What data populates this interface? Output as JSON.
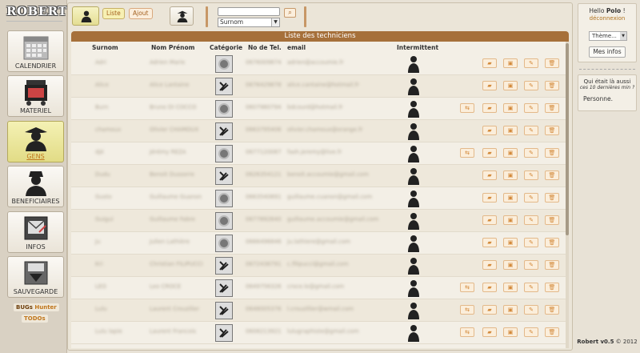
{
  "app": {
    "logo": "ROBERT"
  },
  "sidebar": {
    "items": [
      {
        "label": "CALENDRIER",
        "icon": "calendar-icon"
      },
      {
        "label": "MATERIEL",
        "icon": "equipment-icon"
      },
      {
        "label": "GENS",
        "icon": "people-icon",
        "active": true
      },
      {
        "label": "BENEFICIAIRES",
        "icon": "beneficiary-icon"
      },
      {
        "label": "INFOS",
        "icon": "mail-icon"
      },
      {
        "label": "SAUVEGARDE",
        "icon": "save-icon"
      }
    ],
    "bugs": {
      "prefix": "BUGs",
      "suffix": "Hunter"
    },
    "todos": "TODOs"
  },
  "toolbar": {
    "liste": "Liste",
    "ajout": "Ajout",
    "search_placeholder": "",
    "search_field": "Surnom",
    "search_btn": "⌕"
  },
  "list": {
    "title": "Liste des techniciens",
    "columns": [
      "Surnom",
      "Nom Prénom",
      "Catégorie",
      "No de Tel.",
      "email",
      "Intermittent"
    ],
    "rows": [
      {
        "surnom": "Adri",
        "nom": "Adrien Marie",
        "tel": "0676009874",
        "email": "adrien@accoumie.fr",
        "cat": "disk",
        "extra": false
      },
      {
        "surnom": "Alice",
        "nom": "Alice Lantaine",
        "tel": "0676429878",
        "email": "alice.cantaine@hotmail.fr",
        "cat": "tool",
        "extra": false
      },
      {
        "surnom": "Burn",
        "nom": "Bruno DI COCCO",
        "tel": "0607980794",
        "email": "bdcourd@hotmail.fr",
        "cat": "disk",
        "extra": true
      },
      {
        "surnom": "chamoux",
        "nom": "Olivier CHAMOUX",
        "tel": "0663795406",
        "email": "olivier.chamoux@orange.fr",
        "cat": "tool",
        "extra": false
      },
      {
        "surnom": "djé",
        "nom": "Jérémy REZA",
        "tel": "0677120087",
        "email": "fash.jeremy@live.fr",
        "cat": "disk",
        "extra": true
      },
      {
        "surnom": "Dudu",
        "nom": "Benoit Dussorre",
        "tel": "0626354121",
        "email": "benoit.accoumie@gmail.com",
        "cat": "tool",
        "extra": false
      },
      {
        "surnom": "Gusto",
        "nom": "Guillaume Guanon",
        "tel": "0663540891",
        "email": "guillaume.cuanon@gmail.com",
        "cat": "disk",
        "extra": false
      },
      {
        "surnom": "Guigui",
        "nom": "Guillaume Fabre",
        "tel": "0677892640",
        "email": "guillaume.accoumie@gmail.com",
        "cat": "disk",
        "extra": false
      },
      {
        "surnom": "Ju",
        "nom": "Julien Lathière",
        "tel": "0666496846",
        "email": "ju.lathiere@gmail.com",
        "cat": "disk",
        "extra": false
      },
      {
        "surnom": "Kri",
        "nom": "Christian FILIPUCCI",
        "tel": "0672436791",
        "email": "c.filipucci@gmail.com",
        "cat": "tool",
        "extra": false
      },
      {
        "surnom": "LEO",
        "nom": "Leo CROCE",
        "tel": "0649756326",
        "email": "croce.lo@gmail.com",
        "cat": "tool",
        "extra": true
      },
      {
        "surnom": "Lulu",
        "nom": "Laurent Crouzilier",
        "tel": "0648005376",
        "email": "l.crouzillier@wmail.com",
        "cat": "tool",
        "extra": true
      },
      {
        "surnom": "Lulu lapie",
        "nom": "Laurent Francois",
        "tel": "0608213921",
        "email": "lulugraphiste@gmail.com",
        "cat": "tool",
        "extra": true
      }
    ]
  },
  "user": {
    "hello": "Hello",
    "name": "Polo",
    "bang": "!",
    "logout": "déconnexion",
    "theme": "Thème...",
    "infos": "Mes infos"
  },
  "who": {
    "title": "Qui était là aussi",
    "subtitle": "ces 10 dernières min ?",
    "none": "Personne."
  },
  "footer": {
    "name": "Robert v0.5",
    "copy": "© 2012"
  }
}
